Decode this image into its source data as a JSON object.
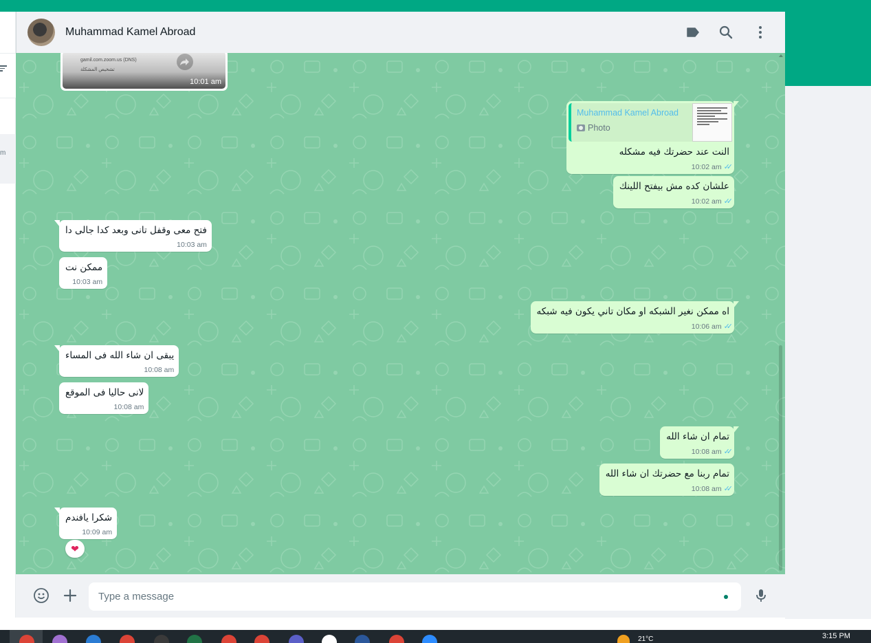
{
  "header": {
    "contact_name": "Muhammad Kamel Abroad"
  },
  "icons": {
    "label": "label-icon",
    "search": "search-icon",
    "menu": "menu-dots-icon",
    "emoji": "emoji-icon",
    "attach": "plus-icon",
    "mic": "mic-icon",
    "read_receipt": "double-check-icon"
  },
  "photo_message": {
    "line1": "gamil.com.zoom.us (DNS)",
    "line2": "تشخيص المشكلة",
    "time": "10:01 am"
  },
  "messages": [
    {
      "dir": "out",
      "quote": {
        "author": "Muhammad Kamel Abroad",
        "type": "Photo"
      },
      "text": "النت عند حضرتك فيه مشكله",
      "time": "10:02 am"
    },
    {
      "dir": "out",
      "text": "علشان كده مش بيفتح اللينك",
      "time": "10:02 am"
    },
    {
      "dir": "in",
      "text": "فتح معى وقفل تانى وبعد كدا جالى دا",
      "time": "10:03 am"
    },
    {
      "dir": "in",
      "text": "ممكن نت",
      "time": "10:03 am"
    },
    {
      "dir": "out",
      "text": "اه ممكن نغير الشبكه او مكان تاني يكون فيه شبكه",
      "time": "10:06 am"
    },
    {
      "dir": "in",
      "text": "يبقى ان شاء الله فى المساء",
      "time": "10:08 am"
    },
    {
      "dir": "in",
      "text": "لانى حاليا فى الموقع",
      "time": "10:08 am"
    },
    {
      "dir": "out",
      "text": "تمام ان شاء الله",
      "time": "10:08 am"
    },
    {
      "dir": "out",
      "text": "تمام ربنا مع حضرتك ان شاء الله",
      "time": "10:08 am"
    },
    {
      "dir": "in",
      "text": "شكرا يافندم",
      "time": "10:09 am"
    }
  ],
  "reaction": "❤",
  "composer": {
    "placeholder": "Type a message"
  },
  "taskbar": {
    "clock": "3:15 PM",
    "temperature": "21°C"
  },
  "colors": {
    "brand_green": "#00a884",
    "chat_bg": "#7fcaa2",
    "bubble_out": "#d9fdd3",
    "bubble_in": "#ffffff",
    "read_tick": "#53bdeb"
  }
}
